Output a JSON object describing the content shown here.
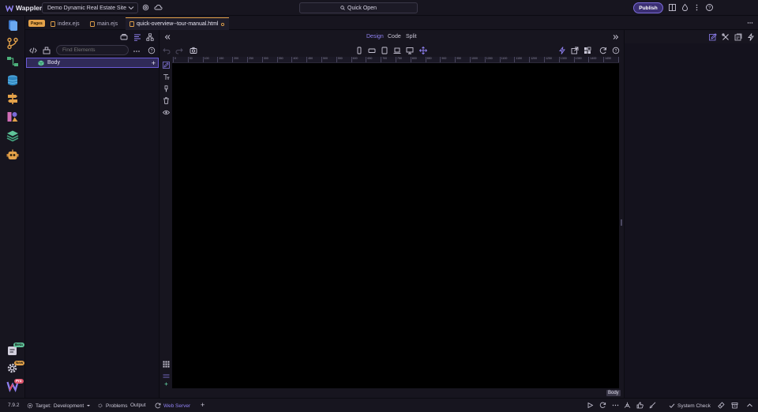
{
  "app": {
    "name": "Wappler",
    "version": "7.9.2",
    "accent_color": "#7b6bd9",
    "tab_accent_color": "#e3a24a"
  },
  "header": {
    "project_name": "Demo Dynamic Real Estate Site",
    "quick_open_label": "Quick Open",
    "publish_label": "Publish"
  },
  "tabs": {
    "section_chip": "Pages",
    "items": [
      {
        "label": "index.ejs"
      },
      {
        "label": "main.ejs"
      },
      {
        "label": "quick-overview--tour-manual.html",
        "active": true
      }
    ]
  },
  "element_panel": {
    "search_placeholder": "Find Elements",
    "tree": [
      {
        "label": "Body",
        "selected": true
      }
    ]
  },
  "design": {
    "modes": [
      {
        "label": "Design",
        "active": true
      },
      {
        "label": "Code"
      },
      {
        "label": "Split"
      }
    ],
    "ruler_ticks": [
      "0",
      "50",
      "100",
      "150",
      "200",
      "250",
      "300",
      "350",
      "400",
      "450",
      "500",
      "550",
      "600",
      "650",
      "700",
      "750",
      "800",
      "850",
      "900",
      "950",
      "1000",
      "1050",
      "1100",
      "1150",
      "1200",
      "1250",
      "1300",
      "1350",
      "1400",
      "1450",
      "15"
    ],
    "selection_label": "Body"
  },
  "rail": {
    "badges": {
      "beta": "Beta",
      "new": "New",
      "pro": "Pro"
    }
  },
  "statusbar": {
    "version": "7.9.2",
    "target_label": "Target:",
    "target_value": "Development",
    "problems_label": "Problems",
    "output_label": "Output",
    "web_server_label": "Web Server",
    "system_check_label": "System Check"
  }
}
